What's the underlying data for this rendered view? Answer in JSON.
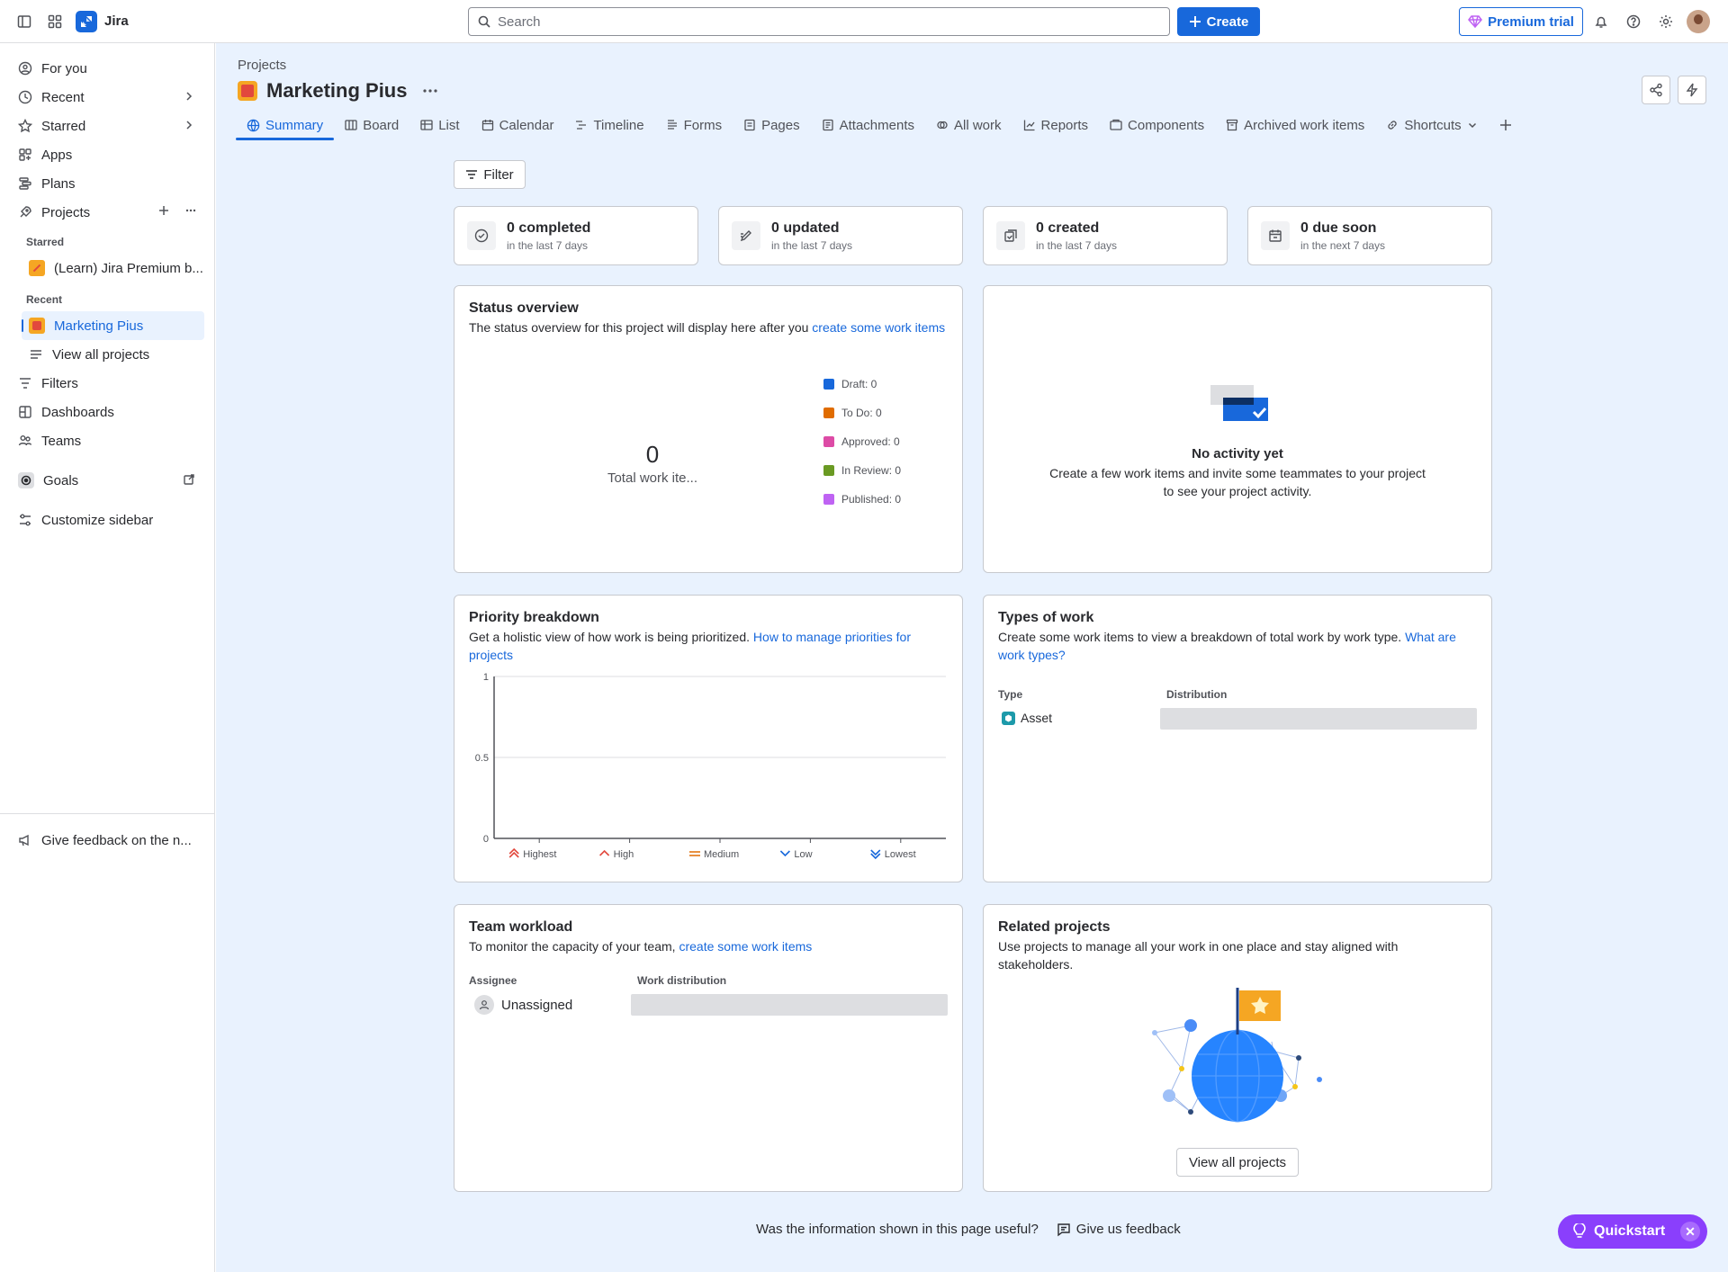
{
  "app": {
    "name": "Jira"
  },
  "search": {
    "placeholder": "Search"
  },
  "topbar": {
    "create_label": "Create",
    "premium_label": "Premium trial"
  },
  "sidebar": {
    "for_you": "For you",
    "recent": "Recent",
    "starred": "Starred",
    "apps": "Apps",
    "plans": "Plans",
    "projects": "Projects",
    "starred_heading": "Starred",
    "starred_project": "(Learn) Jira Premium b...",
    "recent_heading": "Recent",
    "recent_project": "Marketing Pius",
    "view_all_projects": "View all projects",
    "filters": "Filters",
    "dashboards": "Dashboards",
    "teams": "Teams",
    "goals": "Goals",
    "customize": "Customize sidebar",
    "feedback": "Give feedback on the n..."
  },
  "page": {
    "breadcrumb": "Projects",
    "title": "Marketing Pius"
  },
  "tabs": [
    "Summary",
    "Board",
    "List",
    "Calendar",
    "Timeline",
    "Forms",
    "Pages",
    "Attachments",
    "All work",
    "Reports",
    "Components",
    "Archived work items",
    "Shortcuts"
  ],
  "filter_label": "Filter",
  "stats": [
    {
      "title": "0 completed",
      "sub": "in the last 7 days"
    },
    {
      "title": "0 updated",
      "sub": "in the last 7 days"
    },
    {
      "title": "0 created",
      "sub": "in the last 7 days"
    },
    {
      "title": "0 due soon",
      "sub": "in the next 7 days"
    }
  ],
  "status_overview": {
    "title": "Status overview",
    "desc": "The status overview for this project will display here after you ",
    "link": "create some work items",
    "total": "0",
    "total_label": "Total work ite...",
    "legend": [
      {
        "label": "Draft: 0",
        "color": "#1868db"
      },
      {
        "label": "To Do: 0",
        "color": "#e06c00"
      },
      {
        "label": "Approved: 0",
        "color": "#dd4ba6"
      },
      {
        "label": "In Review: 0",
        "color": "#6a9a23"
      },
      {
        "label": "Published: 0",
        "color": "#bf63f3"
      }
    ]
  },
  "activity": {
    "title": "No activity yet",
    "desc": "Create a few work items and invite some teammates to your project to see your project activity."
  },
  "priority": {
    "title": "Priority breakdown",
    "desc": "Get a holistic view of how work is being prioritized. ",
    "link": "How to manage priorities for projects"
  },
  "chart_data": {
    "type": "bar",
    "categories": [
      "Highest",
      "High",
      "Medium",
      "Low",
      "Lowest"
    ],
    "values": [
      0,
      0,
      0,
      0,
      0
    ],
    "ylim": [
      0,
      1
    ],
    "yticks": [
      "1",
      "0.5",
      "0"
    ],
    "grid": true,
    "colors": {
      "Highest": "#e2483d",
      "High": "#e2483d",
      "Medium": "#e06c00",
      "Low": "#1868db",
      "Lowest": "#1868db"
    }
  },
  "types_of_work": {
    "title": "Types of work",
    "desc": "Create some work items to view a breakdown of total work by work type. ",
    "link": "What are work types?",
    "col_type": "Type",
    "col_dist": "Distribution",
    "row_label": "Asset"
  },
  "team_workload": {
    "title": "Team workload",
    "desc": "To monitor the capacity of your team, ",
    "link": "create some work items",
    "col_assignee": "Assignee",
    "col_dist": "Work distribution",
    "row_label": "Unassigned"
  },
  "related": {
    "title": "Related projects",
    "desc": "Use projects to manage all your work in one place and stay aligned with stakeholders.",
    "button": "View all projects"
  },
  "footer": {
    "question": "Was the information shown in this page useful?",
    "feedback": "Give us feedback"
  },
  "quickstart": {
    "label": "Quickstart"
  }
}
